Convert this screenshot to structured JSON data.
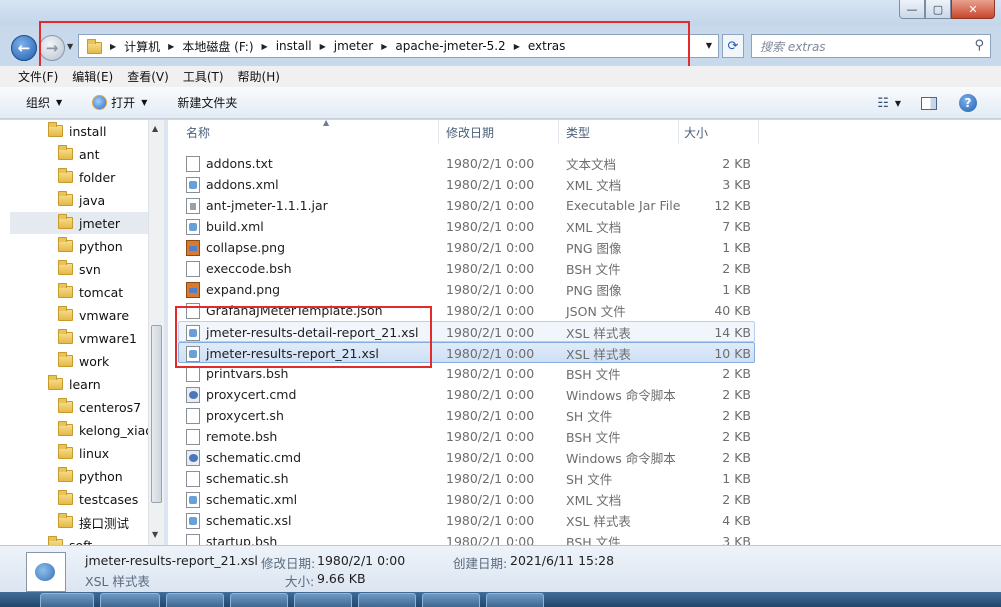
{
  "window": {
    "buttons": {
      "minimize": "—",
      "maximize": "▢",
      "close": "✕"
    }
  },
  "nav": {
    "back_glyph": "←",
    "forward_glyph": "→",
    "breadcrumbs": [
      "计算机",
      "本地磁盘 (F:)",
      "install",
      "jmeter",
      "apache-jmeter-5.2",
      "extras"
    ],
    "search_placeholder": "搜索 extras"
  },
  "menu": [
    "文件(F)",
    "编辑(E)",
    "查看(V)",
    "工具(T)",
    "帮助(H)"
  ],
  "toolbar": {
    "organize": "组织",
    "open": "打开",
    "new_folder": "新建文件夹",
    "help": "?"
  },
  "sidebar": {
    "items": [
      {
        "label": "install"
      },
      {
        "label": "ant"
      },
      {
        "label": "folder"
      },
      {
        "label": "java"
      },
      {
        "label": "jmeter"
      },
      {
        "label": "python"
      },
      {
        "label": "svn"
      },
      {
        "label": "tomcat"
      },
      {
        "label": "vmware"
      },
      {
        "label": "vmware1"
      },
      {
        "label": "work"
      },
      {
        "label": "learn"
      },
      {
        "label": "centeros7"
      },
      {
        "label": "kelong_xiao"
      },
      {
        "label": "linux"
      },
      {
        "label": "python"
      },
      {
        "label": "testcases"
      },
      {
        "label": "接口测试"
      },
      {
        "label": "soft"
      }
    ]
  },
  "columns": {
    "name": "名称",
    "date": "修改日期",
    "type": "类型",
    "size": "大小"
  },
  "files": [
    {
      "name": "addons.txt",
      "date": "1980/2/1 0:00",
      "type": "文本文档",
      "size": "2 KB",
      "icon": "txt-file-icon"
    },
    {
      "name": "addons.xml",
      "date": "1980/2/1 0:00",
      "type": "XML 文档",
      "size": "3 KB",
      "icon": "xml-file-icon"
    },
    {
      "name": "ant-jmeter-1.1.1.jar",
      "date": "1980/2/1 0:00",
      "type": "Executable Jar File",
      "size": "12 KB",
      "icon": "jar-file-icon"
    },
    {
      "name": "build.xml",
      "date": "1980/2/1 0:00",
      "type": "XML 文档",
      "size": "7 KB",
      "icon": "xml-file-icon"
    },
    {
      "name": "collapse.png",
      "date": "1980/2/1 0:00",
      "type": "PNG 图像",
      "size": "1 KB",
      "icon": "png-file-icon"
    },
    {
      "name": "execcode.bsh",
      "date": "1980/2/1 0:00",
      "type": "BSH 文件",
      "size": "2 KB",
      "icon": "bsh-file-icon"
    },
    {
      "name": "expand.png",
      "date": "1980/2/1 0:00",
      "type": "PNG 图像",
      "size": "1 KB",
      "icon": "png-file-icon"
    },
    {
      "name": "GrafanaJMeterTemplate.json",
      "date": "1980/2/1 0:00",
      "type": "JSON 文件",
      "size": "40 KB",
      "icon": "json-file-icon"
    },
    {
      "name": "jmeter-results-detail-report_21.xsl",
      "date": "1980/2/1 0:00",
      "type": "XSL 样式表",
      "size": "14 KB",
      "icon": "xsl-file-icon"
    },
    {
      "name": "jmeter-results-report_21.xsl",
      "date": "1980/2/1 0:00",
      "type": "XSL 样式表",
      "size": "10 KB",
      "icon": "xsl-file-icon"
    },
    {
      "name": "printvars.bsh",
      "date": "1980/2/1 0:00",
      "type": "BSH 文件",
      "size": "2 KB",
      "icon": "bsh-file-icon"
    },
    {
      "name": "proxycert.cmd",
      "date": "1980/2/1 0:00",
      "type": "Windows 命令脚本",
      "size": "2 KB",
      "icon": "cmd-file-icon"
    },
    {
      "name": "proxycert.sh",
      "date": "1980/2/1 0:00",
      "type": "SH 文件",
      "size": "2 KB",
      "icon": "sh-file-icon"
    },
    {
      "name": "remote.bsh",
      "date": "1980/2/1 0:00",
      "type": "BSH 文件",
      "size": "2 KB",
      "icon": "bsh-file-icon"
    },
    {
      "name": "schematic.cmd",
      "date": "1980/2/1 0:00",
      "type": "Windows 命令脚本",
      "size": "2 KB",
      "icon": "cmd-file-icon"
    },
    {
      "name": "schematic.sh",
      "date": "1980/2/1 0:00",
      "type": "SH 文件",
      "size": "1 KB",
      "icon": "sh-file-icon"
    },
    {
      "name": "schematic.xml",
      "date": "1980/2/1 0:00",
      "type": "XML 文档",
      "size": "2 KB",
      "icon": "xml-file-icon"
    },
    {
      "name": "schematic.xsl",
      "date": "1980/2/1 0:00",
      "type": "XSL 样式表",
      "size": "4 KB",
      "icon": "xsl-file-icon"
    },
    {
      "name": "startup.bsh",
      "date": "1980/2/1 0:00",
      "type": "BSH 文件",
      "size": "3 KB",
      "icon": "bsh-file-icon"
    }
  ],
  "details": {
    "filename": "jmeter-results-report_21.xsl",
    "filetype": "XSL 样式表",
    "modified_label": "修改日期:",
    "modified_value": "1980/2/1 0:00",
    "created_label": "创建日期:",
    "created_value": "2021/6/11 15:28",
    "size_label": "大小:",
    "size_value": "9.66 KB"
  },
  "colors": {
    "annotation_red": "#e32b2b",
    "selection": "#cfe0f5"
  }
}
